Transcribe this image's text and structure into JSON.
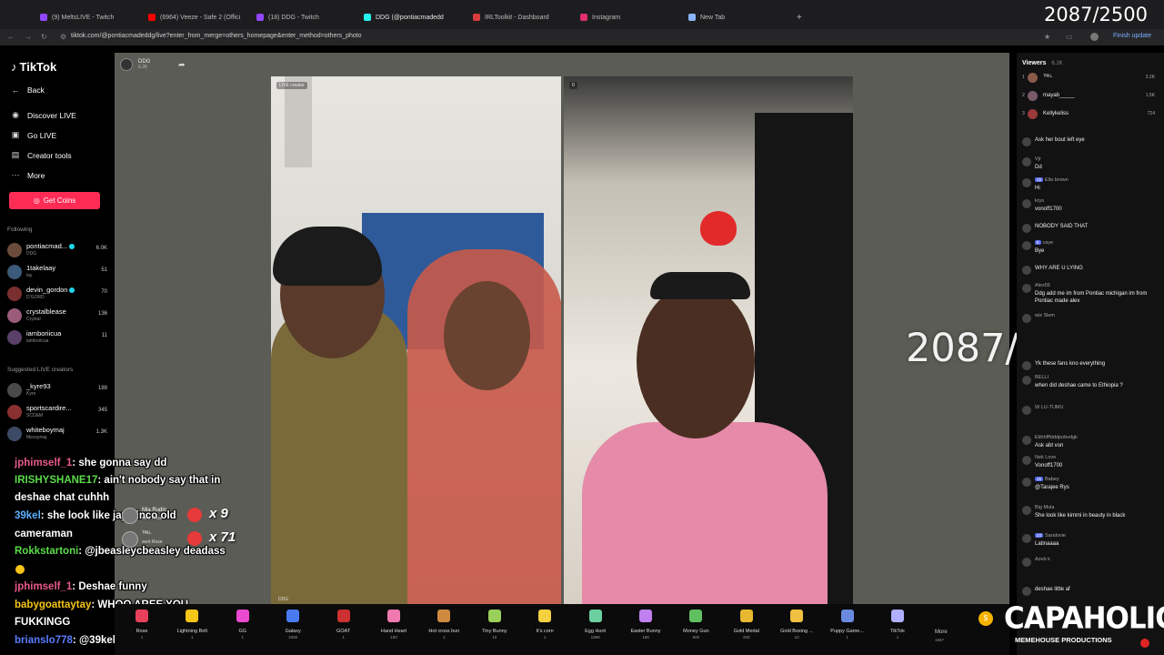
{
  "browser": {
    "tabs": [
      {
        "label": "(9) MeltsLIVE - Twitch",
        "color": "#9146ff"
      },
      {
        "label": "(6964) Veeze - Safe 2 (Offici",
        "color": "#ff0000"
      },
      {
        "label": "(18) DDG - Twitch",
        "color": "#9146ff"
      },
      {
        "label": "DDG (@pontiacmadedd",
        "color": "#25f4ee"
      },
      {
        "label": "IRLToolkit - Dashboard",
        "color": "#d83c3c"
      },
      {
        "label": "Instagram",
        "color": "#e1306c"
      },
      {
        "label": "New Tab",
        "color": "#8ab4f8"
      }
    ],
    "url": "tiktok.com/@pontiacmadeddg/live?enter_from_merge=others_homepage&enter_method=others_photo",
    "finish_update": "Finish update"
  },
  "counter": "2087/2500",
  "tiktok": {
    "logo": "TikTok",
    "back": "Back",
    "menu": [
      {
        "label": "Discover LIVE",
        "icon": "live-icon"
      },
      {
        "label": "Go LIVE",
        "icon": "camera-icon"
      },
      {
        "label": "Creator tools",
        "icon": "tools-icon"
      },
      {
        "label": "More",
        "icon": "more-icon"
      }
    ],
    "get_coins": "Get Coins",
    "following_title": "Following",
    "following": [
      {
        "name": "pontiacmad...",
        "sub": "DDG",
        "count": "6.0K",
        "verified": true,
        "color": "#6b4b3a"
      },
      {
        "name": "1takelaay",
        "sub": "lay",
        "count": "51",
        "verified": false,
        "color": "#3c5a7a"
      },
      {
        "name": "devin_gordon",
        "sub": "D'GORD",
        "count": "70",
        "verified": true,
        "color": "#7a2f2f"
      },
      {
        "name": "crystalblease",
        "sub": "Crystal",
        "count": "136",
        "verified": false,
        "color": "#9b5b7b"
      },
      {
        "name": "iamboriicua",
        "sub": "iamboricua",
        "count": "11",
        "verified": false,
        "color": "#5a3f68"
      }
    ],
    "suggested_title": "Suggested LIVE creators",
    "suggested": [
      {
        "name": "_kyre93",
        "sub": "Kyre",
        "count": "189",
        "color": "#4a4a4a"
      },
      {
        "name": "sportscardire...",
        "sub": "SCD&M",
        "count": "345",
        "color": "#8a3030"
      },
      {
        "name": "whiteboymaj",
        "sub": "Messymaj",
        "count": "1.3K",
        "color": "#3d4a66"
      }
    ],
    "host": "DDG",
    "host_sub": "6.2K",
    "left_video_tag": "LIVE creator",
    "left_video_name": "DDG",
    "right_video_tag": "0"
  },
  "gifts": [
    {
      "name": "Rose",
      "price": "1",
      "color": "#e8405a"
    },
    {
      "name": "Lightning Bolt",
      "price": "1",
      "color": "#f5c518"
    },
    {
      "name": "GG",
      "price": "1",
      "color": "#e94ad0"
    },
    {
      "name": "Galaxy",
      "price": "1000",
      "color": "#4a7af0"
    },
    {
      "name": "GOAT",
      "price": "1",
      "color": "#cc3030"
    },
    {
      "name": "Hand Heart",
      "price": "100",
      "color": "#f07ab0"
    },
    {
      "name": "Hot cross bun",
      "price": "1",
      "color": "#d08a40"
    },
    {
      "name": "Tiny Bunny",
      "price": "10",
      "color": "#9ad05a"
    },
    {
      "name": "It's corn",
      "price": "1",
      "color": "#f5d040"
    },
    {
      "name": "Egg Hunt",
      "price": "1999",
      "color": "#6ad0a0"
    },
    {
      "name": "Easter Bunny",
      "price": "199",
      "color": "#c080f0"
    },
    {
      "name": "Money Gun",
      "price": "500",
      "color": "#60c060"
    },
    {
      "name": "Gold Medal",
      "price": "200",
      "color": "#e8b830"
    },
    {
      "name": "Gold Boxing ...",
      "price": "10",
      "color": "#f0c040"
    },
    {
      "name": "Puppy Game...",
      "price": "1",
      "color": "#6a8ae0"
    },
    {
      "name": "TikTok",
      "price": "1",
      "color": "#b0b0ff"
    }
  ],
  "more_label": "More",
  "more_count": "1557",
  "viewers": {
    "title": "Viewers",
    "count": "6.2K",
    "list": [
      {
        "rank": "1",
        "name": "ᵀᴿᴵᴸᴸ",
        "count": "3.2K",
        "color": "#8a5a4a"
      },
      {
        "rank": "2",
        "name": "mayab_____",
        "count": "1.5K",
        "color": "#7a5a6a"
      },
      {
        "rank": "3",
        "name": "Kellykeliss",
        "count": "724",
        "color": "#9a3a3a"
      }
    ]
  },
  "chat": [
    {
      "user": "",
      "text": "Ask her bout left eye"
    },
    {
      "user": "Vjr",
      "text": "Dd"
    },
    {
      "user": "Ella brown",
      "text": "Hi",
      "badge": "15"
    },
    {
      "user": "krys",
      "text": "vonoff1700"
    },
    {
      "user": "",
      "text": "NOBODY SAID THAT"
    },
    {
      "user": "caye",
      "text": "Bye",
      "badge": "9"
    },
    {
      "user": "",
      "text": "WHY ARE U LYING"
    },
    {
      "user": "Alex55",
      "text": "Ddg add me im from Pontiac michigan im from Pontiac made alex"
    },
    {
      "user": "wiz Slem",
      "text": ""
    },
    {
      "user": "",
      "text": "Yk these fans kno everything"
    },
    {
      "user": "BELLI",
      "text": "when did deshae came to Ethiopia ?"
    },
    {
      "user": "W LU-TUMU",
      "text": ""
    },
    {
      "user": "Etihhfffdddpobvdgk",
      "text": "Ask abt von"
    },
    {
      "user": "Nek Love",
      "text": "Vonoff1700"
    },
    {
      "user": "Babey",
      "text": "@Tarajee Rys",
      "badge": "15"
    },
    {
      "user": "Big Mula",
      "text": "She look like kimmi in beauty in black"
    },
    {
      "user": "Saralovie",
      "text": "Latinaaaa",
      "badge": "24"
    },
    {
      "user": "Azeb k",
      "text": ""
    },
    {
      "user": "",
      "text": "deshae little af"
    }
  ],
  "twitch_chat": [
    {
      "user": "jphimself_1",
      "text": " she gonna say dd",
      "color": "#e85a8a"
    },
    {
      "user": "IRISHYSHANE17",
      "text": " ain't nobody say that in",
      "color": "#5bdc4a"
    },
    {
      "user": "",
      "text": "deshae chat cuhhh",
      "color": "#ffffff"
    },
    {
      "user": "39kel",
      "text": " she look like jay cinco old",
      "color": "#5bb0ff"
    },
    {
      "user": "",
      "text": "cameraman",
      "color": "#ffffff"
    },
    {
      "user": "Rokkstartoni",
      "text": " @jbeasleycbeasley deadass",
      "color": "#5bdc4a"
    },
    {
      "user": "jphimself_1",
      "text": " Deshae funny",
      "color": "#e85a8a"
    },
    {
      "user": "babygoattaytay",
      "text": " WHOO AREE YOU",
      "color": "#f5c518"
    },
    {
      "user": "",
      "text": "FUKKINGG",
      "color": "#ffffff"
    },
    {
      "user": "brianslo778",
      "text": " @39kel",
      "color": "#5b7cff"
    }
  ],
  "gift_notes": [
    {
      "name": "Mia Rudin",
      "sub": "sent Rose",
      "count": "x 9"
    },
    {
      "name": "ᵀᴿᴵᴸᴸ",
      "sub": "sent Rose",
      "count": "x 71"
    }
  ],
  "brand": {
    "main": "CAPAHOLICS",
    "sub": "MEMEHOUSE PRODUCTIONS"
  }
}
